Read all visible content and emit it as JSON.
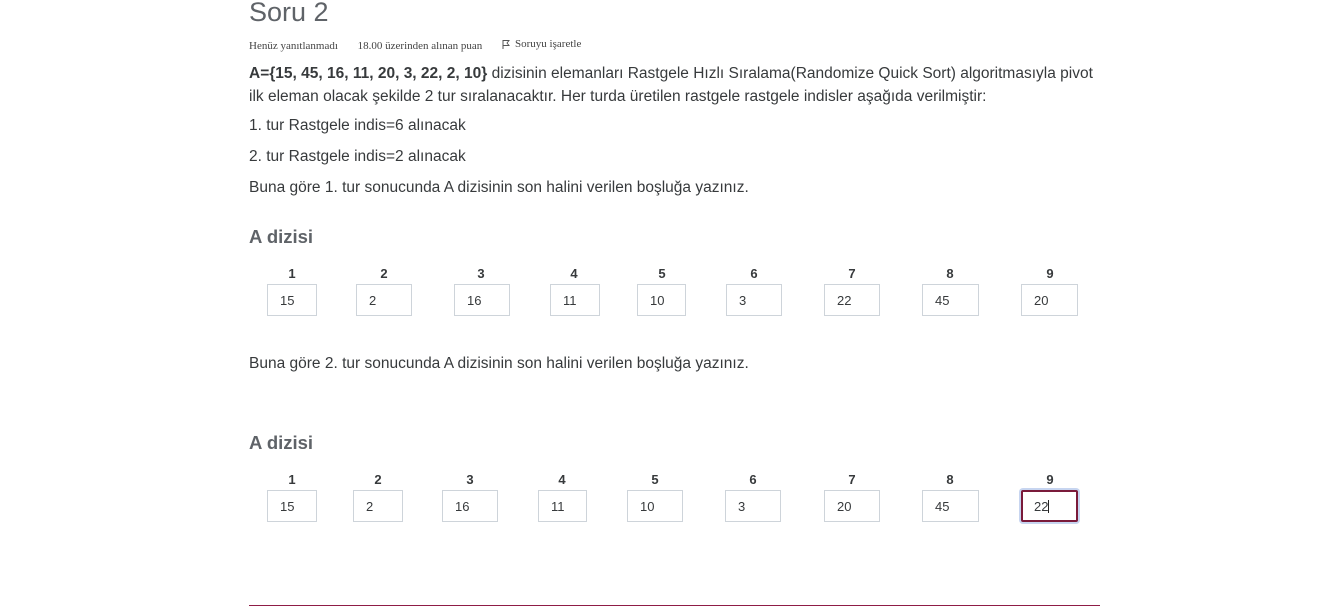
{
  "question": {
    "title": "Soru 2",
    "state": "Henüz yanıtlanmadı",
    "grade": "18.00 üzerinden alınan puan",
    "flag_label": "Soruyu işaretle",
    "array_bold": "A={15, 45, 16, 11, 20, 3, 22, 2, 10}",
    "intro_rest": " dizisinin elemanları Rastgele Hızlı Sıralama(Randomize Quick Sort) algoritmasıyla pivot ilk eleman olacak şekilde 2 tur sıralanacaktır. Her turda üretilen rastgele rastgele indisler aşağıda verilmiştir:",
    "round1_note": "1. tur Rastgele indis=6 alınacak",
    "round2_note": "2. tur Rastgele indis=2 alınacak",
    "prompt1": "Buna göre 1. tur sonucunda A dizisinin son halini verilen boşluğa yazınız.",
    "prompt2": "Buna göre 2. tur sonucunda A dizisinin son halini verilen boşluğa yazınız."
  },
  "table1": {
    "title": "A dizisi",
    "headers": [
      "1",
      "2",
      "3",
      "4",
      "5",
      "6",
      "7",
      "8",
      "9"
    ],
    "values": [
      "15",
      "2",
      "16",
      "11",
      "10",
      "3",
      "22",
      "45",
      "20"
    ]
  },
  "table2": {
    "title": "A dizisi",
    "headers": [
      "1",
      "2",
      "3",
      "4",
      "5",
      "6",
      "7",
      "8",
      "9"
    ],
    "values": [
      "15",
      "2",
      "16",
      "11",
      "10",
      "3",
      "20",
      "45",
      "22"
    ],
    "focused_index": 8
  },
  "icons": {
    "flag": "flag-icon"
  },
  "colors": {
    "accent": "#7a1a3a",
    "focus_ring": "#c7d5f0",
    "rule": "#8f1d46"
  }
}
